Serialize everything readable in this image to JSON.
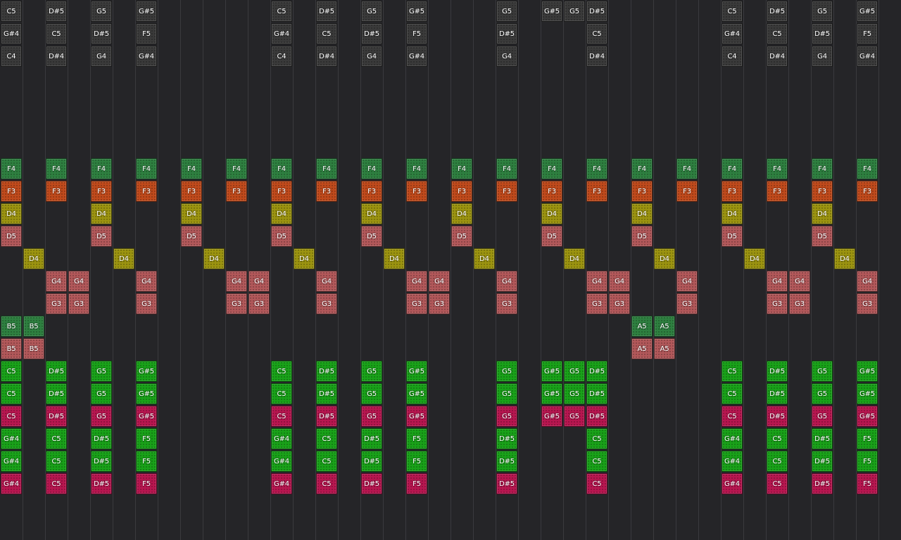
{
  "colors": {
    "background": "#252528",
    "grid_line": "#3a3a3e",
    "gray": "#3a3a3a",
    "leaf_green": "#2e8040",
    "orange": "#c04a1c",
    "olive": "#9c9410",
    "rose": "#b2585a",
    "green": "#19a219",
    "crimson": "#b81650"
  },
  "rows": [
    {
      "color": "gray",
      "cells": {
        "0": "C5",
        "2": "D#5",
        "4": "G5",
        "6": "G#5",
        "12": "C5",
        "14": "D#5",
        "16": "G5",
        "18": "G#5",
        "22": "G5",
        "24": "G#5",
        "25": "G5",
        "26": "D#5",
        "32": "C5",
        "34": "D#5",
        "36": "G5",
        "38": "G#5"
      }
    },
    {
      "color": "gray",
      "cells": {
        "0": "G#4",
        "2": "C5",
        "4": "D#5",
        "6": "F5",
        "12": "G#4",
        "14": "C5",
        "16": "D#5",
        "18": "F5",
        "22": "D#5",
        "26": "C5",
        "32": "G#4",
        "34": "C5",
        "36": "D#5",
        "38": "F5"
      }
    },
    {
      "color": "gray",
      "cells": {
        "0": "C4",
        "2": "D#4",
        "4": "G4",
        "6": "G#4",
        "12": "C4",
        "14": "D#4",
        "16": "G4",
        "18": "G#4",
        "22": "G4",
        "26": "D#4",
        "32": "C4",
        "34": "D#4",
        "36": "G4",
        "38": "G#4"
      }
    },
    {
      "color": "gray",
      "cells": {}
    },
    {
      "color": "gray",
      "cells": {}
    },
    {
      "color": "gray",
      "cells": {}
    },
    {
      "color": "gray",
      "cells": {}
    },
    {
      "color": "leaf_green",
      "cells": {
        "0": "F4",
        "2": "F4",
        "4": "F4",
        "6": "F4",
        "8": "F4",
        "10": "F4",
        "12": "F4",
        "14": "F4",
        "16": "F4",
        "18": "F4",
        "20": "F4",
        "22": "F4",
        "24": "F4",
        "26": "F4",
        "28": "F4",
        "30": "F4",
        "32": "F4",
        "34": "F4",
        "36": "F4",
        "38": "F4"
      }
    },
    {
      "color": "orange",
      "cells": {
        "0": "F3",
        "2": "F3",
        "4": "F3",
        "6": "F3",
        "8": "F3",
        "10": "F3",
        "12": "F3",
        "14": "F3",
        "16": "F3",
        "18": "F3",
        "20": "F3",
        "22": "F3",
        "24": "F3",
        "26": "F3",
        "28": "F3",
        "30": "F3",
        "32": "F3",
        "34": "F3",
        "36": "F3",
        "38": "F3"
      }
    },
    {
      "color": "olive",
      "cells": {
        "0": "D4",
        "4": "D4",
        "8": "D4",
        "12": "D4",
        "16": "D4",
        "20": "D4",
        "24": "D4",
        "28": "D4",
        "32": "D4",
        "36": "D4"
      }
    },
    {
      "color": "rose",
      "cells": {
        "0": "D5",
        "4": "D5",
        "8": "D5",
        "12": "D5",
        "16": "D5",
        "20": "D5",
        "24": "D5",
        "28": "D5",
        "32": "D5",
        "36": "D5"
      }
    },
    {
      "color": "olive",
      "cells": {
        "1": "D4",
        "5": "D4",
        "9": "D4",
        "13": "D4",
        "17": "D4",
        "21": "D4",
        "25": "D4",
        "29": "D4",
        "33": "D4",
        "37": "D4"
      }
    },
    {
      "color": "rose",
      "cells": {
        "2": "G4",
        "3": "G4",
        "6": "G4",
        "10": "G4",
        "11": "G4",
        "14": "G4",
        "18": "G4",
        "19": "G4",
        "22": "G4",
        "26": "G4",
        "27": "G4",
        "30": "G4",
        "34": "G4",
        "35": "G4",
        "38": "G4"
      }
    },
    {
      "color": "rose",
      "cells": {
        "2": "G3",
        "3": "G3",
        "6": "G3",
        "10": "G3",
        "11": "G3",
        "14": "G3",
        "18": "G3",
        "19": "G3",
        "22": "G3",
        "26": "G3",
        "27": "G3",
        "30": "G3",
        "34": "G3",
        "35": "G3",
        "38": "G3"
      }
    },
    {
      "color": "leaf_green",
      "cells": {
        "0": "B5",
        "1": "B5",
        "28": "A5",
        "29": "A5"
      }
    },
    {
      "color": "rose",
      "cells": {
        "0": "B5",
        "1": "B5",
        "28": "A5",
        "29": "A5"
      }
    },
    {
      "color": "green",
      "cells": {
        "0": "C5",
        "2": "D#5",
        "4": "G5",
        "6": "G#5",
        "12": "C5",
        "14": "D#5",
        "16": "G5",
        "18": "G#5",
        "22": "G5",
        "24": "G#5",
        "25": "G5",
        "26": "D#5",
        "32": "C5",
        "34": "D#5",
        "36": "G5",
        "38": "G#5"
      }
    },
    {
      "color": "green",
      "cells": {
        "0": "C5",
        "2": "D#5",
        "4": "G5",
        "6": "G#5",
        "12": "C5",
        "14": "D#5",
        "16": "G5",
        "18": "G#5",
        "22": "G5",
        "24": "G#5",
        "25": "G5",
        "26": "D#5",
        "32": "C5",
        "34": "D#5",
        "36": "G5",
        "38": "G#5"
      }
    },
    {
      "color": "crimson",
      "cells": {
        "0": "C5",
        "2": "D#5",
        "4": "G5",
        "6": "G#5",
        "12": "C5",
        "14": "D#5",
        "16": "G5",
        "18": "G#5",
        "22": "G5",
        "24": "G#5",
        "25": "G5",
        "26": "D#5",
        "32": "C5",
        "34": "D#5",
        "36": "G5",
        "38": "G#5"
      }
    },
    {
      "color": "green",
      "cells": {
        "0": "G#4",
        "2": "C5",
        "4": "D#5",
        "6": "F5",
        "12": "G#4",
        "14": "C5",
        "16": "D#5",
        "18": "F5",
        "22": "D#5",
        "26": "C5",
        "32": "G#4",
        "34": "C5",
        "36": "D#5",
        "38": "F5"
      }
    },
    {
      "color": "green",
      "cells": {
        "0": "G#4",
        "2": "C5",
        "4": "D#5",
        "6": "F5",
        "12": "G#4",
        "14": "C5",
        "16": "D#5",
        "18": "F5",
        "22": "D#5",
        "26": "C5",
        "32": "G#4",
        "34": "C5",
        "36": "D#5",
        "38": "F5"
      }
    },
    {
      "color": "crimson",
      "cells": {
        "0": "G#4",
        "2": "C5",
        "4": "D#5",
        "6": "F5",
        "12": "G#4",
        "14": "C5",
        "16": "D#5",
        "18": "F5",
        "22": "D#5",
        "26": "C5",
        "32": "G#4",
        "34": "C5",
        "36": "D#5",
        "38": "F5"
      }
    }
  ]
}
